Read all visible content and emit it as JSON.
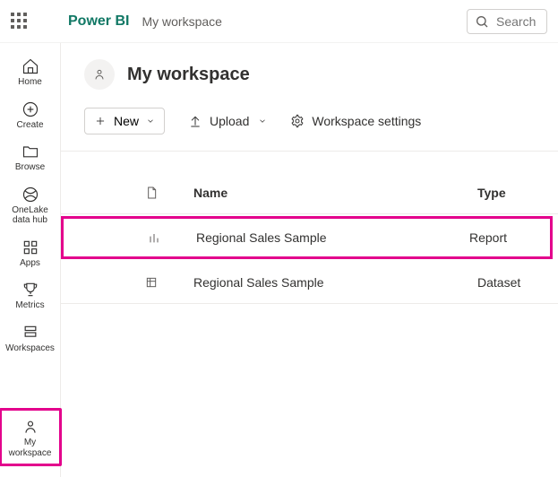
{
  "topbar": {
    "brand": "Power BI",
    "breadcrumb": "My workspace",
    "search_placeholder": "Search"
  },
  "leftnav": {
    "items": [
      {
        "label": "Home"
      },
      {
        "label": "Create"
      },
      {
        "label": "Browse"
      },
      {
        "label": "OneLake data hub"
      },
      {
        "label": "Apps"
      },
      {
        "label": "Metrics"
      },
      {
        "label": "Workspaces"
      },
      {
        "label": "My workspace"
      }
    ]
  },
  "workspace": {
    "title": "My workspace"
  },
  "toolbar": {
    "new_label": "New",
    "upload_label": "Upload",
    "settings_label": "Workspace settings"
  },
  "table": {
    "columns": {
      "name": "Name",
      "type": "Type"
    },
    "rows": [
      {
        "name": "Regional Sales Sample",
        "type": "Report",
        "icon": "report",
        "highlighted": true
      },
      {
        "name": "Regional Sales Sample",
        "type": "Dataset",
        "icon": "dataset",
        "highlighted": false
      }
    ]
  },
  "annotations": {
    "highlight_color": "#e3008c"
  }
}
